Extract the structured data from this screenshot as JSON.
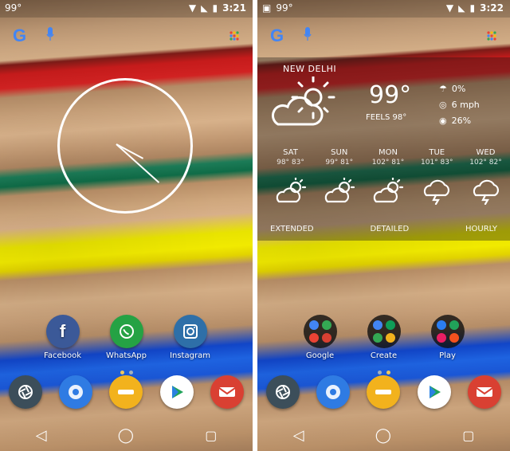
{
  "left": {
    "status": {
      "temp": "99°",
      "time": "3:21"
    },
    "apps": [
      {
        "label": "Facebook"
      },
      {
        "label": "WhatsApp"
      },
      {
        "label": "Instagram"
      }
    ]
  },
  "right": {
    "status": {
      "temp": "99°",
      "time": "3:22"
    },
    "weather": {
      "city": "NEW DELHI",
      "temp": "99°",
      "feels": "FEELS 98°",
      "meta": {
        "precip": "0%",
        "wind": "6 mph",
        "humidity": "26%"
      },
      "days": [
        {
          "name": "SAT",
          "temps": "98° 83°"
        },
        {
          "name": "SUN",
          "temps": "99° 81°"
        },
        {
          "name": "MON",
          "temps": "102° 81°"
        },
        {
          "name": "TUE",
          "temps": "101° 83°"
        },
        {
          "name": "WED",
          "temps": "102° 82°"
        }
      ],
      "tabs": [
        "EXTENDED",
        "DETAILED",
        "HOURLY"
      ]
    },
    "folders": [
      {
        "label": "Google"
      },
      {
        "label": "Create"
      },
      {
        "label": "Play"
      }
    ]
  },
  "colors": {
    "facebook": "#3b5998",
    "whatsapp": "#25a244",
    "instagram": "#2e6fa8",
    "aperture": "#3c4e5a",
    "chrome": "#2f7be3",
    "yellow": "#f2b21d",
    "play": "#21a35a",
    "gmail": "#d94032"
  }
}
